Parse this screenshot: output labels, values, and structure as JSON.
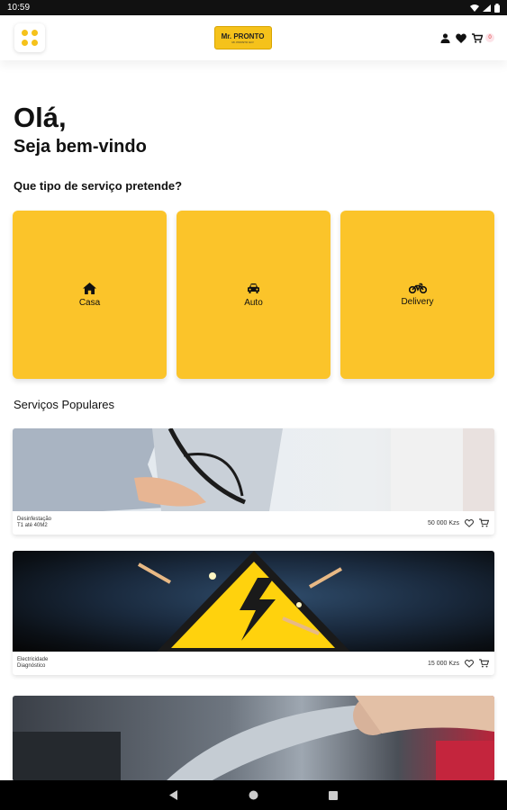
{
  "status_bar": {
    "time": "10:59"
  },
  "app_bar": {
    "logo_text": "Mr. PRONTO",
    "logo_subtext": "Mr. PRONTO GO!",
    "cart_count": "0"
  },
  "greeting": {
    "title": "Olá,",
    "subtitle": "Seja bem-vindo"
  },
  "question": "Que tipo de serviço pretende?",
  "categories": [
    {
      "label": "Casa",
      "icon": "home-icon"
    },
    {
      "label": "Auto",
      "icon": "car-icon"
    },
    {
      "label": "Delivery",
      "icon": "motorcycle-icon"
    }
  ],
  "popular_title": "Serviços Populares",
  "services": [
    {
      "name": "Desinfestação",
      "detail": "T1 até 40M2",
      "price": "50 000 Kzs"
    },
    {
      "name": "Electricidade",
      "detail": "Diagnóstico",
      "price": "15 000 Kzs"
    }
  ],
  "colors": {
    "accent": "#fbc42a",
    "dark": "#111111"
  }
}
